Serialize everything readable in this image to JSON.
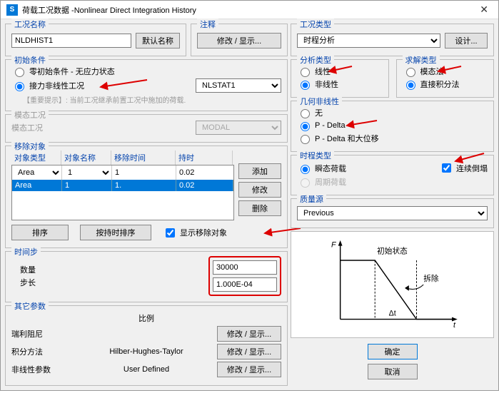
{
  "titlebar": {
    "title": "荷载工况数据 -Nonlinear Direct Integration History"
  },
  "left": {
    "case_name": {
      "title": "工况名称",
      "value": "NLDHIST1",
      "default_btn": "默认名称"
    },
    "notes": {
      "title": "注释",
      "btn": "修改 / 显示..."
    },
    "init_cond": {
      "title": "初始条件",
      "opt_zero": "零初始条件 - 无应力状态",
      "opt_continue": "接力非线性工况",
      "continue_select": "NLSTAT1",
      "hint": "【重要提示】:    当前工况继承前置工况中施加的荷载."
    },
    "modal": {
      "title": "模态工况",
      "label": "模态工况",
      "value": "MODAL"
    },
    "remove": {
      "title": "移除对象",
      "headers": {
        "type": "对象类型",
        "name": "对象名称",
        "time": "移除时间",
        "dur": "持时"
      },
      "input_row": {
        "type": "Area",
        "name": "1",
        "time": "1",
        "dur": "0.02"
      },
      "row1": {
        "type": "Area",
        "name": "1",
        "time": "1.",
        "dur": "0.02"
      },
      "add": "添加",
      "mod": "修改",
      "del": "删除",
      "sort_btn": "排序",
      "sort_by_dur": "按持时排序",
      "show_chk": "显示移除对象"
    },
    "timestep": {
      "title": "时间步",
      "count_label": "数量",
      "count": "30000",
      "step_label": "步长",
      "step": "1.000E-04"
    },
    "other": {
      "title": "其它参数",
      "ratio_header": "比例",
      "rayleigh": "瑞利阻尼",
      "integration": "积分方法",
      "integration_val": "Hilber-Hughes-Taylor",
      "nonlinear": "非线性参数",
      "nonlinear_val": "User Defined",
      "edit1": "修改 / 显示...",
      "edit2": "修改 / 显示...",
      "edit3": "修改 / 显示..."
    }
  },
  "right": {
    "case_type": {
      "title": "工况类型",
      "value": "时程分析",
      "design_btn": "设计..."
    },
    "analysis_type": {
      "title": "分析类型",
      "opt_linear": "线性",
      "opt_nonlinear": "非线性"
    },
    "solution_type": {
      "title": "求解类型",
      "opt_modal": "模态法",
      "opt_direct": "直接积分法"
    },
    "geo_nl": {
      "title": "几何非线性",
      "opt_none": "无",
      "opt_pdelta": "P - Delta",
      "opt_pdelta_large": "P - Delta 和大位移"
    },
    "history_type": {
      "title": "时程类型",
      "opt_transient": "瞬态荷载",
      "opt_periodic": "周期荷载",
      "chk_sustain": "连续倒塌"
    },
    "mass": {
      "title": "质量源",
      "value": "Previous"
    },
    "ok": "确定",
    "cancel": "取消"
  },
  "chart_data": {
    "type": "line",
    "xlabel": "t",
    "ylabel": "F",
    "annotations": [
      "初始状态",
      "拆除",
      "Δt"
    ],
    "series": [
      {
        "name": "F(t)",
        "points": [
          [
            0,
            1
          ],
          [
            0.35,
            1
          ],
          [
            0.7,
            0
          ],
          [
            1,
            0
          ]
        ]
      }
    ]
  }
}
